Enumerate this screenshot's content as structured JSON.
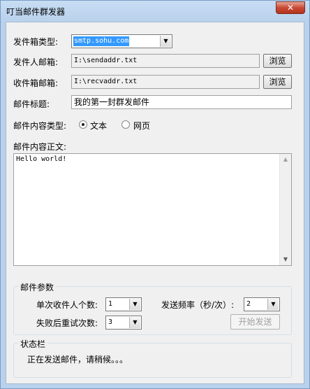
{
  "window": {
    "title": "叮当邮件群发器",
    "close_glyph": "✕"
  },
  "form": {
    "mailbox_type_label": "发件箱类型:",
    "mailbox_type_value": "smtp.sohu.com",
    "sender_label": "发件人邮箱:",
    "sender_value": "I:\\sendaddr.txt",
    "recipient_label": "收件箱邮箱:",
    "recipient_value": "I:\\recvaddr.txt",
    "browse_label": "浏览",
    "subject_label": "邮件标题:",
    "subject_value": "我的第一封群发邮件",
    "content_type_label": "邮件内容类型:",
    "content_type_options": [
      {
        "label": "文本",
        "selected": true
      },
      {
        "label": "网页",
        "selected": false
      }
    ],
    "body_label": "邮件内容正文:",
    "body_value": "Hello world!"
  },
  "params": {
    "legend": "邮件参数",
    "per_batch_label": "单次收件人个数:",
    "per_batch_value": "1",
    "frequency_label": "发送频率（秒/次）:",
    "frequency_value": "2",
    "retry_label": "失败后重试次数:",
    "retry_value": "3",
    "start_button": "开始发送"
  },
  "status": {
    "legend": "状态栏",
    "text": "正在发送邮件，请稍候。。。"
  },
  "icons": {
    "dropdown": "chevron-down-icon",
    "scroll_up": "scroll-up-icon",
    "scroll_down": "scroll-down-icon"
  }
}
